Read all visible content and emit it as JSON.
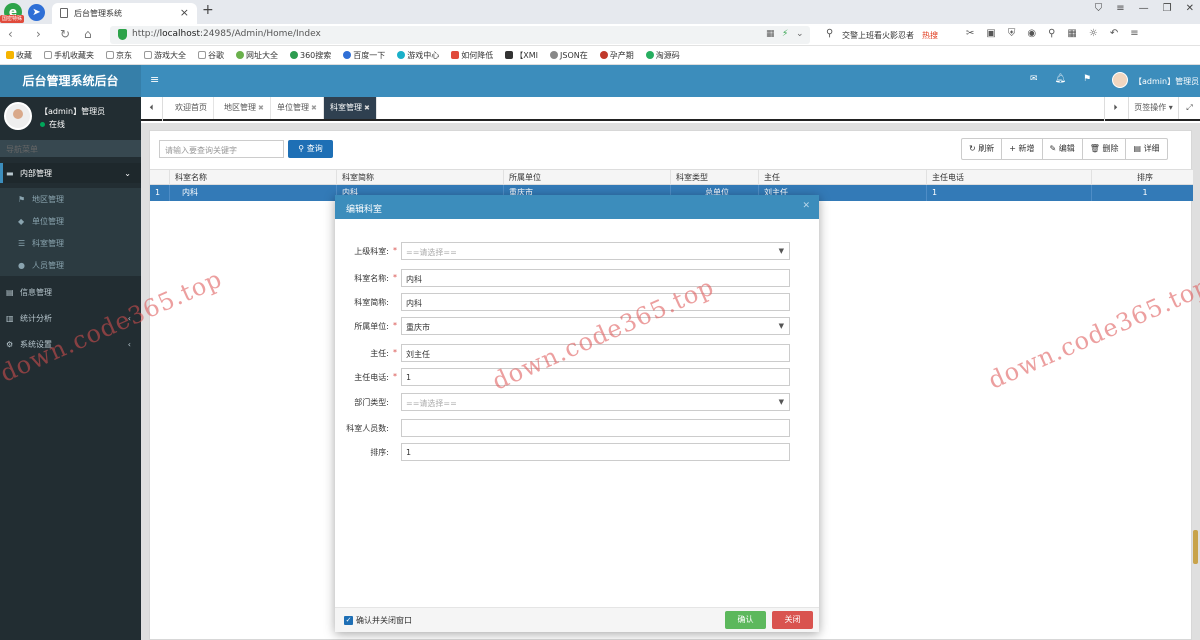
{
  "browser": {
    "badge": "国密特殊",
    "tab_title": "后台管理系统",
    "url_prefix": "http://",
    "url_host": "localhost",
    "url_path": ":24985/Admin/Home/Index",
    "search_text": "交警上班看火影忍者",
    "search_hot": "热搜",
    "bookmarks": [
      "收藏",
      "手机收藏夹",
      "京东",
      "游戏大全",
      "谷歌",
      "网址大全",
      "360搜索",
      "百度一下",
      "游戏中心",
      "如何降低",
      "【XMI",
      "JSON在",
      "孕产期",
      "淘源码"
    ]
  },
  "header": {
    "brand": "后台管理系统后台",
    "user": "【admin】管理员"
  },
  "sidebar": {
    "user_name": "【admin】管理员",
    "status": "在线",
    "search_placeholder": "导航菜单",
    "groups": [
      {
        "label": "内部管理",
        "icon": "card-icon"
      },
      {
        "label": "信息管理",
        "icon": "doc-icon"
      },
      {
        "label": "统计分析",
        "icon": "chart-icon"
      },
      {
        "label": "系统设置",
        "icon": "gear-icon"
      }
    ],
    "subitems": [
      {
        "label": "地区管理",
        "icon": "flag-icon"
      },
      {
        "label": "单位管理",
        "icon": "diamond-icon"
      },
      {
        "label": "科室管理",
        "icon": "list-icon"
      },
      {
        "label": "人员管理",
        "icon": "user-icon"
      }
    ]
  },
  "tabs": {
    "items": [
      "欢迎首页",
      "地区管理",
      "单位管理",
      "科室管理"
    ],
    "ops": "页签操作"
  },
  "toolbar": {
    "search_placeholder": "请输入要查询关键字",
    "search_btn": "查询",
    "refresh": "刷新",
    "add": "新增",
    "edit": "编辑",
    "delete": "删除",
    "detail": "详细"
  },
  "grid": {
    "columns": [
      "科室名称",
      "科室简称",
      "所属单位",
      "科室类型",
      "主任",
      "主任电话",
      "排序"
    ],
    "rows": [
      {
        "no": "1",
        "name": "内科",
        "short": "内科",
        "unit": "重庆市",
        "type": "总单位",
        "director": "刘主任",
        "phone": "1",
        "sort": "1"
      }
    ]
  },
  "dialog": {
    "title": "编辑科室",
    "fields": [
      {
        "label": "上级科室:",
        "required": "*",
        "value": "==请选择==",
        "select": true
      },
      {
        "label": "科室名称:",
        "required": "*",
        "value": "内科"
      },
      {
        "label": "科室简称:",
        "required": "",
        "value": "内科"
      },
      {
        "label": "所属单位:",
        "required": "*",
        "value": "重庆市",
        "select": true
      },
      {
        "label": "主任:",
        "required": "*",
        "value": "刘主任"
      },
      {
        "label": "主任电话:",
        "required": "*",
        "value": "1"
      },
      {
        "label": "部门类型:",
        "required": "",
        "value": "==请选择==",
        "select": true
      },
      {
        "label": "科室人员数:",
        "required": "",
        "value": ""
      },
      {
        "label": "排序:",
        "required": "",
        "value": "1"
      }
    ],
    "checkbox_label": "确认并关闭窗口",
    "ok": "确认",
    "close": "关闭"
  },
  "watermark": "down.code365.top",
  "colors": {
    "header": "#3c8dbc",
    "sidebar": "#222d32",
    "selected_row": "#337ab7",
    "ok": "#5cb85c",
    "close": "#d9534f"
  }
}
